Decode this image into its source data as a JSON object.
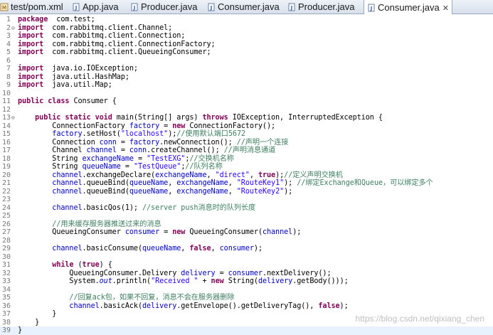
{
  "tabs": [
    {
      "label": "test/pom.xml",
      "icon": "xml-file-icon",
      "active": false
    },
    {
      "label": "App.java",
      "icon": "java-file-icon",
      "active": false
    },
    {
      "label": "Producer.java",
      "icon": "java-file-icon",
      "active": false
    },
    {
      "label": "Consumer.java",
      "icon": "java-file-icon",
      "active": false
    },
    {
      "label": "Producer.java",
      "icon": "java-file-icon",
      "active": false
    },
    {
      "label": "Consumer.java",
      "icon": "java-file-icon",
      "active": true,
      "close": "✕"
    }
  ],
  "editor": {
    "lines": [
      {
        "n": "1",
        "m": "",
        "hl": false,
        "t": [
          [
            "kw",
            "package"
          ],
          [
            "",
            "  com.test;"
          ]
        ]
      },
      {
        "n": "2",
        "m": "⊖",
        "hl": false,
        "t": [
          [
            "kw",
            "import"
          ],
          [
            "",
            "  com.rabbitmq.client.Channel;"
          ]
        ]
      },
      {
        "n": "3",
        "m": "",
        "hl": false,
        "t": [
          [
            "kw",
            "import"
          ],
          [
            "",
            "  com.rabbitmq.client.Connection;"
          ]
        ]
      },
      {
        "n": "4",
        "m": "",
        "hl": false,
        "t": [
          [
            "kw",
            "import"
          ],
          [
            "",
            "  com.rabbitmq.client.ConnectionFactory;"
          ]
        ]
      },
      {
        "n": "5",
        "m": "",
        "hl": false,
        "t": [
          [
            "kw",
            "import"
          ],
          [
            "",
            "  com.rabbitmq.client.QueueingConsumer;"
          ]
        ]
      },
      {
        "n": "6",
        "m": "",
        "hl": false,
        "t": []
      },
      {
        "n": "7",
        "m": "",
        "hl": false,
        "t": [
          [
            "kw",
            "import"
          ],
          [
            "",
            "  java.io.IOException;"
          ]
        ]
      },
      {
        "n": "8",
        "m": "",
        "hl": false,
        "t": [
          [
            "kw",
            "import"
          ],
          [
            "",
            "  java.util.HashMap;"
          ]
        ]
      },
      {
        "n": "9",
        "m": "",
        "hl": false,
        "t": [
          [
            "kw",
            "import"
          ],
          [
            "",
            "  java.util.Map;"
          ]
        ]
      },
      {
        "n": "10",
        "m": "",
        "hl": false,
        "t": []
      },
      {
        "n": "11",
        "m": "",
        "hl": false,
        "t": [
          [
            "kw",
            "public class"
          ],
          [
            "",
            " Consumer {"
          ]
        ]
      },
      {
        "n": "12",
        "m": "",
        "hl": false,
        "t": []
      },
      {
        "n": "13",
        "m": "⊖",
        "hl": false,
        "t": [
          [
            "",
            "    "
          ],
          [
            "kw",
            "public static void"
          ],
          [
            "",
            " main(String[] args) "
          ],
          [
            "kw",
            "throws"
          ],
          [
            "",
            " IOException, InterruptedException {"
          ]
        ]
      },
      {
        "n": "14",
        "m": "",
        "hl": false,
        "t": [
          [
            "",
            "        ConnectionFactory "
          ],
          [
            "fld",
            "factory"
          ],
          [
            "",
            " = "
          ],
          [
            "kw",
            "new"
          ],
          [
            "",
            " ConnectionFactory();"
          ]
        ]
      },
      {
        "n": "15",
        "m": "",
        "hl": false,
        "t": [
          [
            "",
            "        "
          ],
          [
            "fld",
            "factory"
          ],
          [
            "",
            ".setHost("
          ],
          [
            "str",
            "\"localhost\""
          ],
          [
            "",
            ");"
          ],
          [
            "cm",
            "//使用默认端口5672"
          ]
        ]
      },
      {
        "n": "16",
        "m": "",
        "hl": false,
        "t": [
          [
            "",
            "        Connection "
          ],
          [
            "fld",
            "conn"
          ],
          [
            "",
            " = "
          ],
          [
            "fld",
            "factory"
          ],
          [
            "",
            ".newConnection(); "
          ],
          [
            "cm",
            "//声明一个连接"
          ]
        ]
      },
      {
        "n": "17",
        "m": "",
        "hl": false,
        "t": [
          [
            "",
            "        Channel "
          ],
          [
            "fld",
            "channel"
          ],
          [
            "",
            " = "
          ],
          [
            "fld",
            "conn"
          ],
          [
            "",
            ".createChannel(); "
          ],
          [
            "cm",
            "//声明消息通道"
          ]
        ]
      },
      {
        "n": "18",
        "m": "",
        "hl": false,
        "t": [
          [
            "",
            "        String "
          ],
          [
            "fld",
            "exchangeName"
          ],
          [
            "",
            " = "
          ],
          [
            "str",
            "\"TestEXG\""
          ],
          [
            "",
            ";"
          ],
          [
            "cm",
            "//交换机名称"
          ]
        ]
      },
      {
        "n": "19",
        "m": "",
        "hl": false,
        "t": [
          [
            "",
            "        String "
          ],
          [
            "fld",
            "queueName"
          ],
          [
            "",
            " = "
          ],
          [
            "str",
            "\"TestQueue\""
          ],
          [
            "",
            ";"
          ],
          [
            "cm",
            "//队列名称"
          ]
        ]
      },
      {
        "n": "20",
        "m": "",
        "hl": false,
        "t": [
          [
            "",
            "        "
          ],
          [
            "fld",
            "channel"
          ],
          [
            "",
            ".exchangeDeclare("
          ],
          [
            "fld",
            "exchangeName"
          ],
          [
            "",
            ", "
          ],
          [
            "str",
            "\"direct\""
          ],
          [
            "",
            ", "
          ],
          [
            "kw",
            "true"
          ],
          [
            "",
            ");"
          ],
          [
            "cm",
            "//定义声明交换机"
          ]
        ]
      },
      {
        "n": "21",
        "m": "",
        "hl": false,
        "t": [
          [
            "",
            "        "
          ],
          [
            "fld",
            "channel"
          ],
          [
            "",
            ".queueBind("
          ],
          [
            "fld",
            "queueName"
          ],
          [
            "",
            ", "
          ],
          [
            "fld",
            "exchangeName"
          ],
          [
            "",
            ", "
          ],
          [
            "str",
            "\"RouteKey1\""
          ],
          [
            "",
            "); "
          ],
          [
            "cm",
            "//绑定Exchange和Queue，可以绑定多个"
          ]
        ]
      },
      {
        "n": "22",
        "m": "",
        "hl": false,
        "t": [
          [
            "",
            "        "
          ],
          [
            "fld",
            "channel"
          ],
          [
            "",
            ".queueBind("
          ],
          [
            "fld",
            "queueName"
          ],
          [
            "",
            ", "
          ],
          [
            "fld",
            "exchangeName"
          ],
          [
            "",
            ", "
          ],
          [
            "str",
            "\"RouteKey2\""
          ],
          [
            "",
            ");"
          ]
        ]
      },
      {
        "n": "23",
        "m": "",
        "hl": false,
        "t": []
      },
      {
        "n": "24",
        "m": "",
        "hl": false,
        "t": [
          [
            "",
            "        "
          ],
          [
            "fld",
            "channel"
          ],
          [
            "",
            ".basicQos(1); "
          ],
          [
            "cm",
            "//server push消息时的队列长度"
          ]
        ]
      },
      {
        "n": "25",
        "m": "",
        "hl": false,
        "t": []
      },
      {
        "n": "26",
        "m": "",
        "hl": false,
        "t": [
          [
            "",
            "        "
          ],
          [
            "cm",
            "//用来缓存服务器推送过来的消息"
          ]
        ]
      },
      {
        "n": "27",
        "m": "",
        "hl": false,
        "t": [
          [
            "",
            "        QueueingConsumer "
          ],
          [
            "fld",
            "consumer"
          ],
          [
            "",
            " = "
          ],
          [
            "kw",
            "new"
          ],
          [
            "",
            " QueueingConsumer("
          ],
          [
            "fld",
            "channel"
          ],
          [
            "",
            ");"
          ]
        ]
      },
      {
        "n": "28",
        "m": "",
        "hl": false,
        "t": []
      },
      {
        "n": "29",
        "m": "",
        "hl": false,
        "t": [
          [
            "",
            "        "
          ],
          [
            "fld",
            "channel"
          ],
          [
            "",
            ".basicConsume("
          ],
          [
            "fld",
            "queueName"
          ],
          [
            "",
            ", "
          ],
          [
            "kw",
            "false"
          ],
          [
            "",
            ", "
          ],
          [
            "fld",
            "consumer"
          ],
          [
            "",
            ");"
          ]
        ]
      },
      {
        "n": "30",
        "m": "",
        "hl": false,
        "t": []
      },
      {
        "n": "31",
        "m": "",
        "hl": false,
        "t": [
          [
            "",
            "        "
          ],
          [
            "kw",
            "while"
          ],
          [
            "",
            " ("
          ],
          [
            "kw",
            "true"
          ],
          [
            "",
            ") {"
          ]
        ]
      },
      {
        "n": "32",
        "m": "",
        "hl": false,
        "t": [
          [
            "",
            "            QueueingConsumer.Delivery "
          ],
          [
            "fld",
            "delivery"
          ],
          [
            "",
            " = "
          ],
          [
            "fld",
            "consumer"
          ],
          [
            "",
            ".nextDelivery();"
          ]
        ]
      },
      {
        "n": "33",
        "m": "",
        "hl": false,
        "t": [
          [
            "",
            "            System."
          ],
          [
            "sf",
            "out"
          ],
          [
            "",
            ".println("
          ],
          [
            "str",
            "\"Received \""
          ],
          [
            "",
            " + "
          ],
          [
            "kw",
            "new"
          ],
          [
            "",
            " String("
          ],
          [
            "fld",
            "delivery"
          ],
          [
            "",
            ".getBody()));"
          ]
        ]
      },
      {
        "n": "34",
        "m": "",
        "hl": false,
        "t": []
      },
      {
        "n": "35",
        "m": "",
        "hl": false,
        "t": [
          [
            "",
            "            "
          ],
          [
            "cm",
            "//回复ack包，如果不回复，消息不会在服务器删除"
          ]
        ]
      },
      {
        "n": "36",
        "m": "",
        "hl": false,
        "t": [
          [
            "",
            "            "
          ],
          [
            "fld",
            "channel"
          ],
          [
            "",
            ".basicAck("
          ],
          [
            "fld",
            "delivery"
          ],
          [
            "",
            ".getEnvelope().getDeliveryTag(), "
          ],
          [
            "kw",
            "false"
          ],
          [
            "",
            ");"
          ]
        ]
      },
      {
        "n": "37",
        "m": "",
        "hl": false,
        "t": [
          [
            "",
            "        }"
          ]
        ]
      },
      {
        "n": "38",
        "m": "",
        "hl": false,
        "t": [
          [
            "",
            "    }"
          ]
        ]
      },
      {
        "n": "39",
        "m": "",
        "hl": true,
        "t": [
          [
            "",
            "}"
          ]
        ]
      }
    ]
  },
  "watermark": "https://blog.csdn.net/qixiang_chen",
  "colors": {
    "keyword": "#7f0055",
    "string": "#2a00ff",
    "comment": "#3f7f5f",
    "field": "#0000c0"
  }
}
